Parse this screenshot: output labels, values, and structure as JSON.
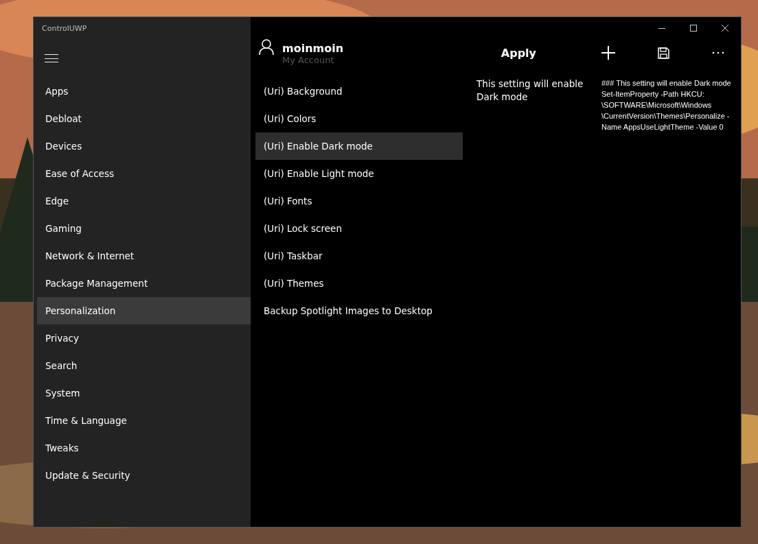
{
  "window": {
    "title": "ControlUWP"
  },
  "sidebar": {
    "items": [
      {
        "label": "Apps",
        "selected": false
      },
      {
        "label": "Debloat",
        "selected": false
      },
      {
        "label": "Devices",
        "selected": false
      },
      {
        "label": "Ease of Access",
        "selected": false
      },
      {
        "label": "Edge",
        "selected": false
      },
      {
        "label": "Gaming",
        "selected": false
      },
      {
        "label": "Network & Internet",
        "selected": false
      },
      {
        "label": "Package Management",
        "selected": false
      },
      {
        "label": "Personalization",
        "selected": true
      },
      {
        "label": "Privacy",
        "selected": false
      },
      {
        "label": "Search",
        "selected": false
      },
      {
        "label": "System",
        "selected": false
      },
      {
        "label": "Time & Language",
        "selected": false
      },
      {
        "label": "Tweaks",
        "selected": false
      },
      {
        "label": "Update & Security",
        "selected": false
      }
    ]
  },
  "account": {
    "name": "moinmoin",
    "subtitle": "My Account"
  },
  "toolbar": {
    "apply": "Apply"
  },
  "settings": [
    {
      "label": "(Uri) Background",
      "selected": false
    },
    {
      "label": "(Uri) Colors",
      "selected": false
    },
    {
      "label": "(Uri) Enable Dark mode",
      "selected": true
    },
    {
      "label": "(Uri) Enable Light mode",
      "selected": false
    },
    {
      "label": "(Uri) Fonts",
      "selected": false
    },
    {
      "label": "(Uri) Lock screen",
      "selected": false
    },
    {
      "label": "(Uri) Taskbar",
      "selected": false
    },
    {
      "label": "(Uri) Themes",
      "selected": false
    },
    {
      "label": "Backup Spotlight Images to Desktop",
      "selected": false
    }
  ],
  "description": "This setting will enable Dark mode",
  "script": [
    "### This setting will enable Dark mode",
    "Set-ItemProperty -Path HKCU:",
    "\\SOFTWARE\\Microsoft\\Windows",
    "\\CurrentVersion\\Themes\\Personalize -",
    "Name AppsUseLightTheme -Value 0"
  ]
}
